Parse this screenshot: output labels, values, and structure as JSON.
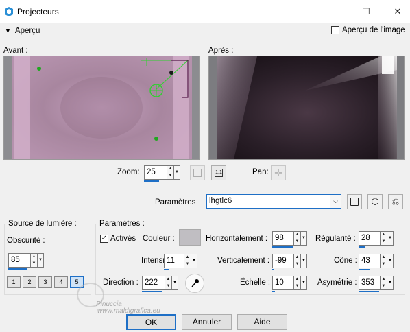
{
  "window": {
    "title": "Projecteurs"
  },
  "preview": {
    "toggle_label": "Aperçu",
    "image_preview_checkbox_label": "Aperçu de l'image",
    "before_label": "Avant :",
    "after_label": "Après :",
    "zoom_label": "Zoom:",
    "zoom_value": "25",
    "pan_label": "Pan:"
  },
  "presets": {
    "label": "Paramètres",
    "value": "lhgtlc6"
  },
  "light_source": {
    "group_label": "Source de lumière :",
    "darkness_label": "Obscurité :",
    "darkness_value": "85",
    "preset_numbers": [
      "1",
      "2",
      "3",
      "4",
      "5"
    ]
  },
  "parameters": {
    "group_label": "Paramètres :",
    "enabled_label": "Activés",
    "color_label": "Couleur :",
    "intensity_label": "Intensité :",
    "intensity_value": "11",
    "direction_label": "Direction :",
    "direction_value": "222",
    "horizontal_label": "Horizontalement :",
    "horizontal_value": "98",
    "vertical_label": "Verticalement :",
    "vertical_value": "-99",
    "scale_label": "Échelle :",
    "scale_value": "10",
    "regularity_label": "Régularité :",
    "regularity_value": "28",
    "cone_label": "Cône :",
    "cone_value": "43",
    "asymmetry_label": "Asymétrie :",
    "asymmetry_value": "353"
  },
  "buttons": {
    "ok": "OK",
    "cancel": "Annuler",
    "help": "Aide"
  },
  "watermark": {
    "line1": "Pinuccia",
    "line2": "www.maldigrafica.eu"
  },
  "colors": {
    "accent": "#1e6fc6",
    "swatch": "#c0bec2",
    "preview_pink": "#c9a2c4",
    "preview_dark": "#2a1f28"
  }
}
